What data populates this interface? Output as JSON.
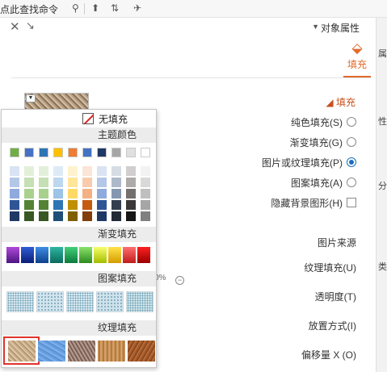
{
  "topbar": {
    "command_search_label": "点此查找命令",
    "search_icon": "search-icon",
    "icons": [
      "share-icon",
      "cloud-sync-icon",
      "pin-icon"
    ]
  },
  "panel": {
    "title": "对象属性",
    "close_icon": "close-icon",
    "collapse_icon": "collapse-icon",
    "tab_label": "填充",
    "tab_icon": "paint-bucket-icon",
    "accent_color": "#e06a2c"
  },
  "fill_section": {
    "header": "填充",
    "options": [
      {
        "label": "纯色填充(S)",
        "selected": false
      },
      {
        "label": "渐变填充(G)",
        "selected": false
      },
      {
        "label": "图片或纹理填充(P)",
        "selected": true
      },
      {
        "label": "图案填充(A)",
        "selected": false
      }
    ],
    "hide_background": "隐藏背景图形(H)"
  },
  "properties": {
    "picture_source": "图片来源",
    "texture_fill": "纹理填充(U)",
    "transparency": "透明度(T)",
    "transparency_value": "0%",
    "placement": "放置方式(I)",
    "offset_x": "偏移量 X (O)"
  },
  "right_strip": [
    "属",
    "性",
    "分",
    "类"
  ],
  "popup": {
    "no_fill": "无填充",
    "theme_colors_header": "主题颜色",
    "gradient_header": "渐变填充",
    "pattern_header": "图案填充",
    "texture_header": "纹理填充",
    "theme_top_row": [
      "#ffffff",
      "#e7e6e6",
      "#a5a5a5",
      "#44546a",
      "#4472c4",
      "#ed7d31",
      "#ffc000",
      "#4472c4",
      "#70ad47",
      "#70ad47"
    ],
    "theme_top_row_order_rtl": [
      "#ffffff",
      "#e0e0e0",
      "#a6a6a6",
      "#1f3864",
      "#4472c4",
      "#ed7d31",
      "#ffc000",
      "#2e75b6",
      "#4472c4",
      "#70ad47"
    ],
    "theme_columns": [
      [
        "#f2f2f2",
        "#d9d9d9",
        "#bfbfbf",
        "#a6a6a6",
        "#808080"
      ],
      [
        "#d0cece",
        "#aeaaaa",
        "#757070",
        "#3a3838",
        "#171616"
      ],
      [
        "#d6dce4",
        "#adb9ca",
        "#8497b0",
        "#333f4f",
        "#222a35"
      ],
      [
        "#dae3f3",
        "#b4c7e7",
        "#8faadc",
        "#2f5597",
        "#1f3864"
      ],
      [
        "#fbe5d6",
        "#f8cbad",
        "#f4b183",
        "#c55a11",
        "#833c0b"
      ],
      [
        "#fff2cc",
        "#ffe699",
        "#ffd966",
        "#bf9000",
        "#7f6000"
      ],
      [
        "#deebf7",
        "#bdd7ee",
        "#9dc3e6",
        "#2e75b6",
        "#1f4e79"
      ],
      [
        "#e2f0d9",
        "#c5e0b4",
        "#a9d18e",
        "#548235",
        "#385723"
      ],
      [
        "#e2f0d9",
        "#c5e0b4",
        "#a9d18e",
        "#548235",
        "#385723"
      ],
      [
        "#dae3f3",
        "#b4c7e7",
        "#8faadc",
        "#2f5597",
        "#1f3864"
      ]
    ],
    "gradient_colors": [
      [
        "#ff2020",
        "#9b0000"
      ],
      [
        "#ff7070",
        "#c11b1b"
      ],
      [
        "#ffe44a",
        "#d49b00"
      ],
      [
        "#f7ff6a",
        "#a4bd00"
      ],
      [
        "#8be36c",
        "#2c8a1d"
      ],
      [
        "#44d07a",
        "#0b7a3c"
      ],
      [
        "#2fb7a2",
        "#096a5c"
      ],
      [
        "#3f8ee6",
        "#0d3f8d"
      ],
      [
        "#2f5cd4",
        "#0a1e7a"
      ],
      [
        "#b04ad9",
        "#4d1582"
      ]
    ],
    "pattern_colors": [
      "#d7e7f1",
      "#d2e4ee",
      "#d7e9f2",
      "#cfe2ec",
      "#cde5ea"
    ],
    "texture_names": [
      "brown-marble",
      "wood-grain",
      "granite",
      "blue-tissue",
      "sand"
    ],
    "selected_texture": "sand",
    "selection_color": "#e0342c"
  }
}
